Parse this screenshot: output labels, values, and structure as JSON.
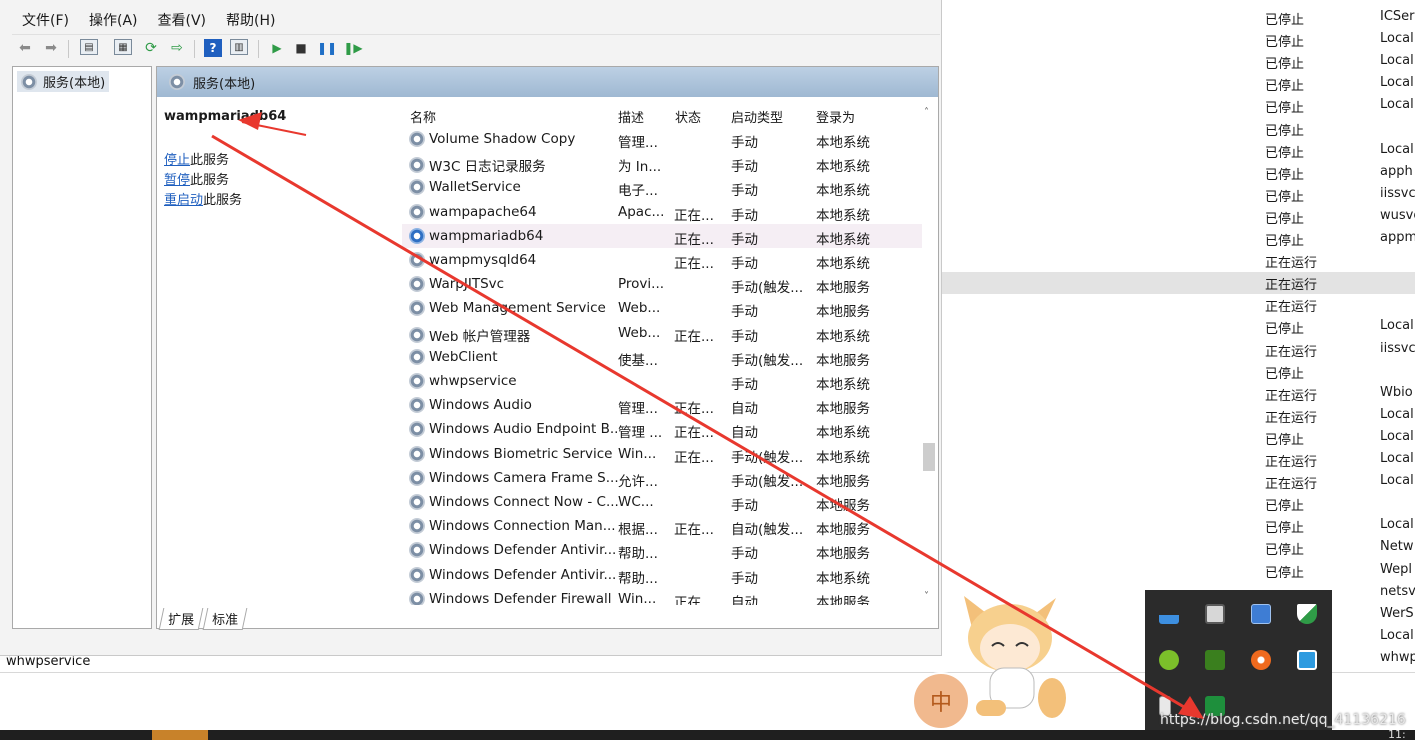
{
  "window": {
    "menu": [
      "文件(F)",
      "操作(A)",
      "查看(V)",
      "帮助(H)"
    ]
  },
  "tree": {
    "root": "服务(本地)"
  },
  "detail": {
    "header": "服务(本地)",
    "selected_service": "wampmariadb64",
    "actions": [
      {
        "link": "停止",
        "rest": "此服务"
      },
      {
        "link": "暂停",
        "rest": "此服务"
      },
      {
        "link": "重启动",
        "rest": "此服务"
      }
    ],
    "columns": [
      "名称",
      "描述",
      "状态",
      "启动类型",
      "登录为"
    ],
    "rows": [
      {
        "name": "Volume Shadow Copy",
        "desc": "管理...",
        "status": "",
        "start": "手动",
        "logon": "本地系统"
      },
      {
        "name": "W3C 日志记录服务",
        "desc": "为 In...",
        "status": "",
        "start": "手动",
        "logon": "本地系统"
      },
      {
        "name": "WalletService",
        "desc": "电子...",
        "status": "",
        "start": "手动",
        "logon": "本地系统"
      },
      {
        "name": "wampapache64",
        "desc": "Apac...",
        "status": "正在...",
        "start": "手动",
        "logon": "本地系统"
      },
      {
        "name": "wampmariadb64",
        "desc": "",
        "status": "正在...",
        "start": "手动",
        "logon": "本地系统"
      },
      {
        "name": "wampmysqld64",
        "desc": "",
        "status": "正在...",
        "start": "手动",
        "logon": "本地系统"
      },
      {
        "name": "WarpJITSvc",
        "desc": "Provi...",
        "status": "",
        "start": "手动(触发...",
        "logon": "本地服务"
      },
      {
        "name": "Web Management Service",
        "desc": "Web...",
        "status": "",
        "start": "手动",
        "logon": "本地服务"
      },
      {
        "name": "Web 帐户管理器",
        "desc": "Web...",
        "status": "正在...",
        "start": "手动",
        "logon": "本地系统"
      },
      {
        "name": "WebClient",
        "desc": "使基...",
        "status": "",
        "start": "手动(触发...",
        "logon": "本地服务"
      },
      {
        "name": "whwpservice",
        "desc": "",
        "status": "",
        "start": "手动",
        "logon": "本地系统"
      },
      {
        "name": "Windows Audio",
        "desc": "管理...",
        "status": "正在...",
        "start": "自动",
        "logon": "本地服务"
      },
      {
        "name": "Windows Audio Endpoint B...",
        "desc": "管理 ...",
        "status": "正在...",
        "start": "自动",
        "logon": "本地系统"
      },
      {
        "name": "Windows Biometric Service",
        "desc": "Win...",
        "status": "正在...",
        "start": "手动(触发...",
        "logon": "本地系统"
      },
      {
        "name": "Windows Camera Frame S...",
        "desc": "允许...",
        "status": "",
        "start": "手动(触发...",
        "logon": "本地服务"
      },
      {
        "name": "Windows Connect Now - C...",
        "desc": "WC...",
        "status": "",
        "start": "手动",
        "logon": "本地服务"
      },
      {
        "name": "Windows Connection Man...",
        "desc": "根据...",
        "status": "正在...",
        "start": "自动(触发...",
        "logon": "本地服务"
      },
      {
        "name": "Windows Defender Antivir...",
        "desc": "帮助...",
        "status": "",
        "start": "手动",
        "logon": "本地服务"
      },
      {
        "name": "Windows Defender Antivir...",
        "desc": "帮助...",
        "status": "",
        "start": "手动",
        "logon": "本地系统"
      },
      {
        "name": "Windows Defender Firewall",
        "desc": "Win...",
        "status": "正在...",
        "start": "自动",
        "logon": "本地服务"
      }
    ],
    "tabs": [
      "扩展",
      "标准"
    ]
  },
  "status_bar": "whwpservice",
  "background_rows": [
    {
      "status": "已停止",
      "logon": "ICSer"
    },
    {
      "status": "已停止",
      "logon": "Local"
    },
    {
      "status": "已停止",
      "logon": "Local"
    },
    {
      "status": "已停止",
      "logon": "Local"
    },
    {
      "status": "已停止",
      "logon": "Local"
    },
    {
      "status": "已停止",
      "logon": ""
    },
    {
      "status": "已停止",
      "logon": "Local"
    },
    {
      "status": "已停止",
      "logon": "apph"
    },
    {
      "status": "已停止",
      "logon": "iissvc"
    },
    {
      "status": "已停止",
      "logon": "wusvc"
    },
    {
      "status": "已停止",
      "logon": "appm"
    },
    {
      "status": "正在运行",
      "logon": ""
    },
    {
      "status": "正在运行",
      "logon": ""
    },
    {
      "status": "正在运行",
      "logon": ""
    },
    {
      "status": "已停止",
      "logon": "Local"
    },
    {
      "status": "正在运行",
      "logon": "iissvc"
    },
    {
      "status": "已停止",
      "logon": ""
    },
    {
      "status": "正在运行",
      "logon": "Wbio"
    },
    {
      "status": "正在运行",
      "logon": "Local"
    },
    {
      "status": "已停止",
      "logon": "Local"
    },
    {
      "status": "正在运行",
      "logon": "Local"
    },
    {
      "status": "正在运行",
      "logon": "Local"
    },
    {
      "status": "已停止",
      "logon": ""
    },
    {
      "status": "已停止",
      "logon": "Local"
    },
    {
      "status": "已停止",
      "logon": "Netw"
    },
    {
      "status": "已停止",
      "logon": "Wepl"
    },
    {
      "status": "",
      "logon": "netsv"
    },
    {
      "status": "",
      "logon": "WerS"
    },
    {
      "status": "",
      "logon": "Local"
    },
    {
      "status": "",
      "logon": "whwp"
    }
  ],
  "tray": {
    "badge": "中",
    "watermark": "https://blog.csdn.net/qq_41136216",
    "clock": "11:"
  },
  "colors": {
    "arrow": "#e8382e",
    "header_blue": "#b4c9df",
    "link": "#1f5fbf"
  }
}
